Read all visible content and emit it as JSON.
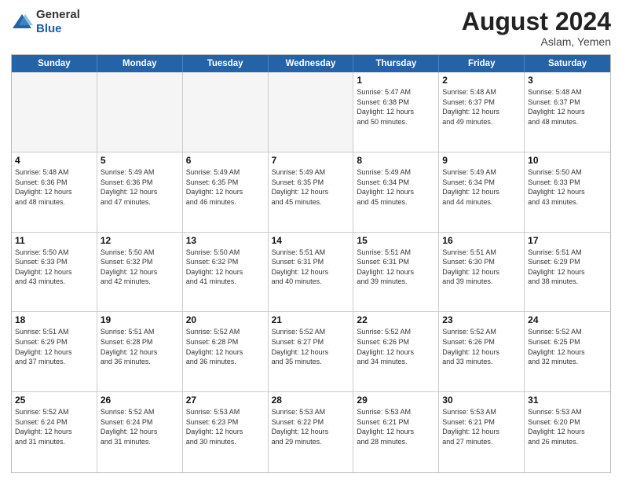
{
  "logo": {
    "general": "General",
    "blue": "Blue"
  },
  "title": "August 2024",
  "location": "Aslam, Yemen",
  "weekdays": [
    "Sunday",
    "Monday",
    "Tuesday",
    "Wednesday",
    "Thursday",
    "Friday",
    "Saturday"
  ],
  "rows": [
    [
      {
        "day": "",
        "detail": "",
        "empty": true
      },
      {
        "day": "",
        "detail": "",
        "empty": true
      },
      {
        "day": "",
        "detail": "",
        "empty": true
      },
      {
        "day": "",
        "detail": "",
        "empty": true
      },
      {
        "day": "1",
        "detail": "Sunrise: 5:47 AM\nSunset: 6:38 PM\nDaylight: 12 hours\nand 50 minutes.",
        "empty": false
      },
      {
        "day": "2",
        "detail": "Sunrise: 5:48 AM\nSunset: 6:37 PM\nDaylight: 12 hours\nand 49 minutes.",
        "empty": false
      },
      {
        "day": "3",
        "detail": "Sunrise: 5:48 AM\nSunset: 6:37 PM\nDaylight: 12 hours\nand 48 minutes.",
        "empty": false
      }
    ],
    [
      {
        "day": "4",
        "detail": "Sunrise: 5:48 AM\nSunset: 6:36 PM\nDaylight: 12 hours\nand 48 minutes.",
        "empty": false
      },
      {
        "day": "5",
        "detail": "Sunrise: 5:49 AM\nSunset: 6:36 PM\nDaylight: 12 hours\nand 47 minutes.",
        "empty": false
      },
      {
        "day": "6",
        "detail": "Sunrise: 5:49 AM\nSunset: 6:35 PM\nDaylight: 12 hours\nand 46 minutes.",
        "empty": false
      },
      {
        "day": "7",
        "detail": "Sunrise: 5:49 AM\nSunset: 6:35 PM\nDaylight: 12 hours\nand 45 minutes.",
        "empty": false
      },
      {
        "day": "8",
        "detail": "Sunrise: 5:49 AM\nSunset: 6:34 PM\nDaylight: 12 hours\nand 45 minutes.",
        "empty": false
      },
      {
        "day": "9",
        "detail": "Sunrise: 5:49 AM\nSunset: 6:34 PM\nDaylight: 12 hours\nand 44 minutes.",
        "empty": false
      },
      {
        "day": "10",
        "detail": "Sunrise: 5:50 AM\nSunset: 6:33 PM\nDaylight: 12 hours\nand 43 minutes.",
        "empty": false
      }
    ],
    [
      {
        "day": "11",
        "detail": "Sunrise: 5:50 AM\nSunset: 6:33 PM\nDaylight: 12 hours\nand 43 minutes.",
        "empty": false
      },
      {
        "day": "12",
        "detail": "Sunrise: 5:50 AM\nSunset: 6:32 PM\nDaylight: 12 hours\nand 42 minutes.",
        "empty": false
      },
      {
        "day": "13",
        "detail": "Sunrise: 5:50 AM\nSunset: 6:32 PM\nDaylight: 12 hours\nand 41 minutes.",
        "empty": false
      },
      {
        "day": "14",
        "detail": "Sunrise: 5:51 AM\nSunset: 6:31 PM\nDaylight: 12 hours\nand 40 minutes.",
        "empty": false
      },
      {
        "day": "15",
        "detail": "Sunrise: 5:51 AM\nSunset: 6:31 PM\nDaylight: 12 hours\nand 39 minutes.",
        "empty": false
      },
      {
        "day": "16",
        "detail": "Sunrise: 5:51 AM\nSunset: 6:30 PM\nDaylight: 12 hours\nand 39 minutes.",
        "empty": false
      },
      {
        "day": "17",
        "detail": "Sunrise: 5:51 AM\nSunset: 6:29 PM\nDaylight: 12 hours\nand 38 minutes.",
        "empty": false
      }
    ],
    [
      {
        "day": "18",
        "detail": "Sunrise: 5:51 AM\nSunset: 6:29 PM\nDaylight: 12 hours\nand 37 minutes.",
        "empty": false
      },
      {
        "day": "19",
        "detail": "Sunrise: 5:51 AM\nSunset: 6:28 PM\nDaylight: 12 hours\nand 36 minutes.",
        "empty": false
      },
      {
        "day": "20",
        "detail": "Sunrise: 5:52 AM\nSunset: 6:28 PM\nDaylight: 12 hours\nand 36 minutes.",
        "empty": false
      },
      {
        "day": "21",
        "detail": "Sunrise: 5:52 AM\nSunset: 6:27 PM\nDaylight: 12 hours\nand 35 minutes.",
        "empty": false
      },
      {
        "day": "22",
        "detail": "Sunrise: 5:52 AM\nSunset: 6:26 PM\nDaylight: 12 hours\nand 34 minutes.",
        "empty": false
      },
      {
        "day": "23",
        "detail": "Sunrise: 5:52 AM\nSunset: 6:26 PM\nDaylight: 12 hours\nand 33 minutes.",
        "empty": false
      },
      {
        "day": "24",
        "detail": "Sunrise: 5:52 AM\nSunset: 6:25 PM\nDaylight: 12 hours\nand 32 minutes.",
        "empty": false
      }
    ],
    [
      {
        "day": "25",
        "detail": "Sunrise: 5:52 AM\nSunset: 6:24 PM\nDaylight: 12 hours\nand 31 minutes.",
        "empty": false
      },
      {
        "day": "26",
        "detail": "Sunrise: 5:52 AM\nSunset: 6:24 PM\nDaylight: 12 hours\nand 31 minutes.",
        "empty": false
      },
      {
        "day": "27",
        "detail": "Sunrise: 5:53 AM\nSunset: 6:23 PM\nDaylight: 12 hours\nand 30 minutes.",
        "empty": false
      },
      {
        "day": "28",
        "detail": "Sunrise: 5:53 AM\nSunset: 6:22 PM\nDaylight: 12 hours\nand 29 minutes.",
        "empty": false
      },
      {
        "day": "29",
        "detail": "Sunrise: 5:53 AM\nSunset: 6:21 PM\nDaylight: 12 hours\nand 28 minutes.",
        "empty": false
      },
      {
        "day": "30",
        "detail": "Sunrise: 5:53 AM\nSunset: 6:21 PM\nDaylight: 12 hours\nand 27 minutes.",
        "empty": false
      },
      {
        "day": "31",
        "detail": "Sunrise: 5:53 AM\nSunset: 6:20 PM\nDaylight: 12 hours\nand 26 minutes.",
        "empty": false
      }
    ]
  ]
}
